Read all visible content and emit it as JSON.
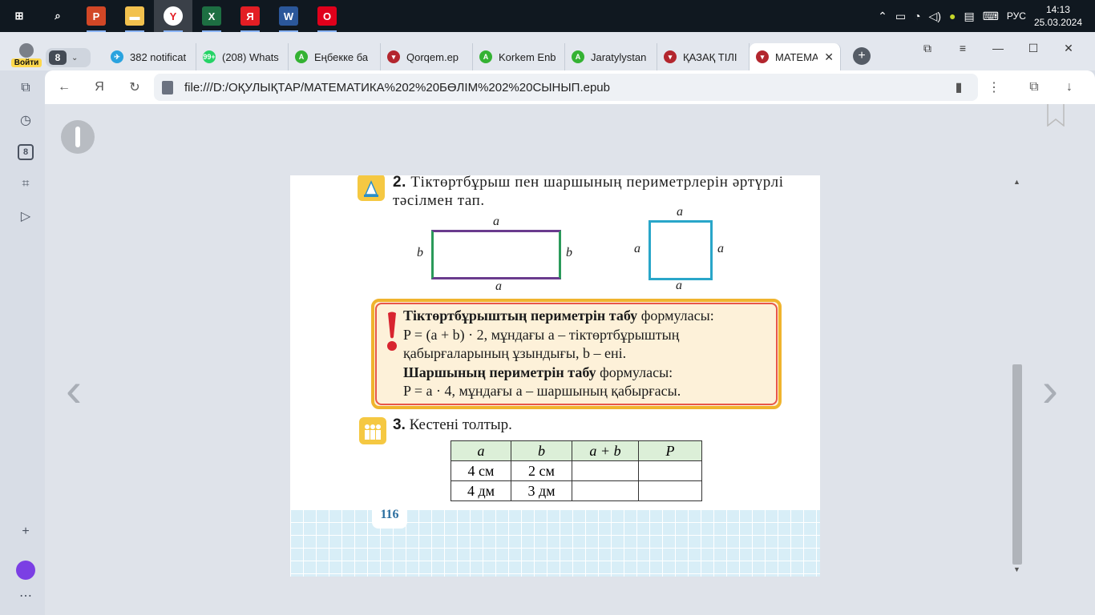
{
  "taskbar": {
    "apps": [
      {
        "name": "start-button",
        "glyph": "⊞",
        "color": "#101820"
      },
      {
        "name": "search",
        "glyph": "⌕",
        "color": "#101820"
      },
      {
        "name": "powerpoint",
        "glyph": "P",
        "color": "#d24726"
      },
      {
        "name": "file-explorer",
        "glyph": "▬",
        "color": "#f2c14e"
      },
      {
        "name": "yandex-browser",
        "glyph": "Y",
        "color": "#ffffff"
      },
      {
        "name": "excel",
        "glyph": "X",
        "color": "#1d6f42"
      },
      {
        "name": "yandex",
        "glyph": "Я",
        "color": "#e31e24"
      },
      {
        "name": "word",
        "glyph": "W",
        "color": "#2b579a"
      },
      {
        "name": "opera",
        "glyph": "O",
        "color": "#e0001b"
      }
    ],
    "language": "РУС",
    "time": "14:13",
    "date": "25.03.2024"
  },
  "browser": {
    "login_label": "Войти",
    "tab_count": "8",
    "tabs": [
      {
        "title": "382 notificat",
        "fav_color": "#2aa3df",
        "fav_glyph": "✈"
      },
      {
        "title": "(208) Whats",
        "fav_color": "#25d366",
        "fav_glyph": "99+"
      },
      {
        "title": "Еңбекке ба",
        "fav_color": "#34b233",
        "fav_glyph": "A"
      },
      {
        "title": "Qorqem.ep",
        "fav_color": "#b3262e",
        "fav_glyph": "▾"
      },
      {
        "title": "Korkem Enb",
        "fav_color": "#34b233",
        "fav_glyph": "A"
      },
      {
        "title": "Jaratylystan",
        "fav_color": "#34b233",
        "fav_glyph": "A"
      },
      {
        "title": "ҚАЗАҚ ТІЛІ",
        "fav_color": "#b3262e",
        "fav_glyph": "▾"
      },
      {
        "title": "МАТЕМА",
        "fav_color": "#b3262e",
        "fav_glyph": "▾"
      }
    ],
    "close_symbol": "✕",
    "new_tab_symbol": "+",
    "address": "file:///D:/ОҚУЛЫҚТАР/МАТЕМАТИКА%202%20БӨЛІМ%202%20СЫНЫП.epub",
    "sidebar_count": "8"
  },
  "book": {
    "task2_num": "2.",
    "task2_text": "Тіктөртбұрыш пен шаршының периметрлерін әртүрлі тәсілмен тап.",
    "lab_a": "a",
    "lab_b": "b",
    "rule_line1_bold": "Тіктөртбұрыштың периметрін табу",
    "rule_line1_rest": " формуласы:",
    "rule_line2": "P = (a + b) · 2, мұндағы  a – тіктөртбұрыштың қабырғаларының ұзындығы, b – ені.",
    "rule_line3_bold": "Шаршының периметрін табу",
    "rule_line3_rest": " формуласы:",
    "rule_line4": "P = a · 4, мұндағы a – шаршының қабырғасы.",
    "task3_num": "3.",
    "task3_text": "Кестені толтыр.",
    "table": {
      "headers": [
        "a",
        "b",
        "a + b",
        "P"
      ],
      "rows": [
        [
          "4 см",
          "2 см",
          "",
          ""
        ],
        [
          "4 дм",
          "3 дм",
          "",
          ""
        ]
      ]
    },
    "page_number": "116"
  }
}
